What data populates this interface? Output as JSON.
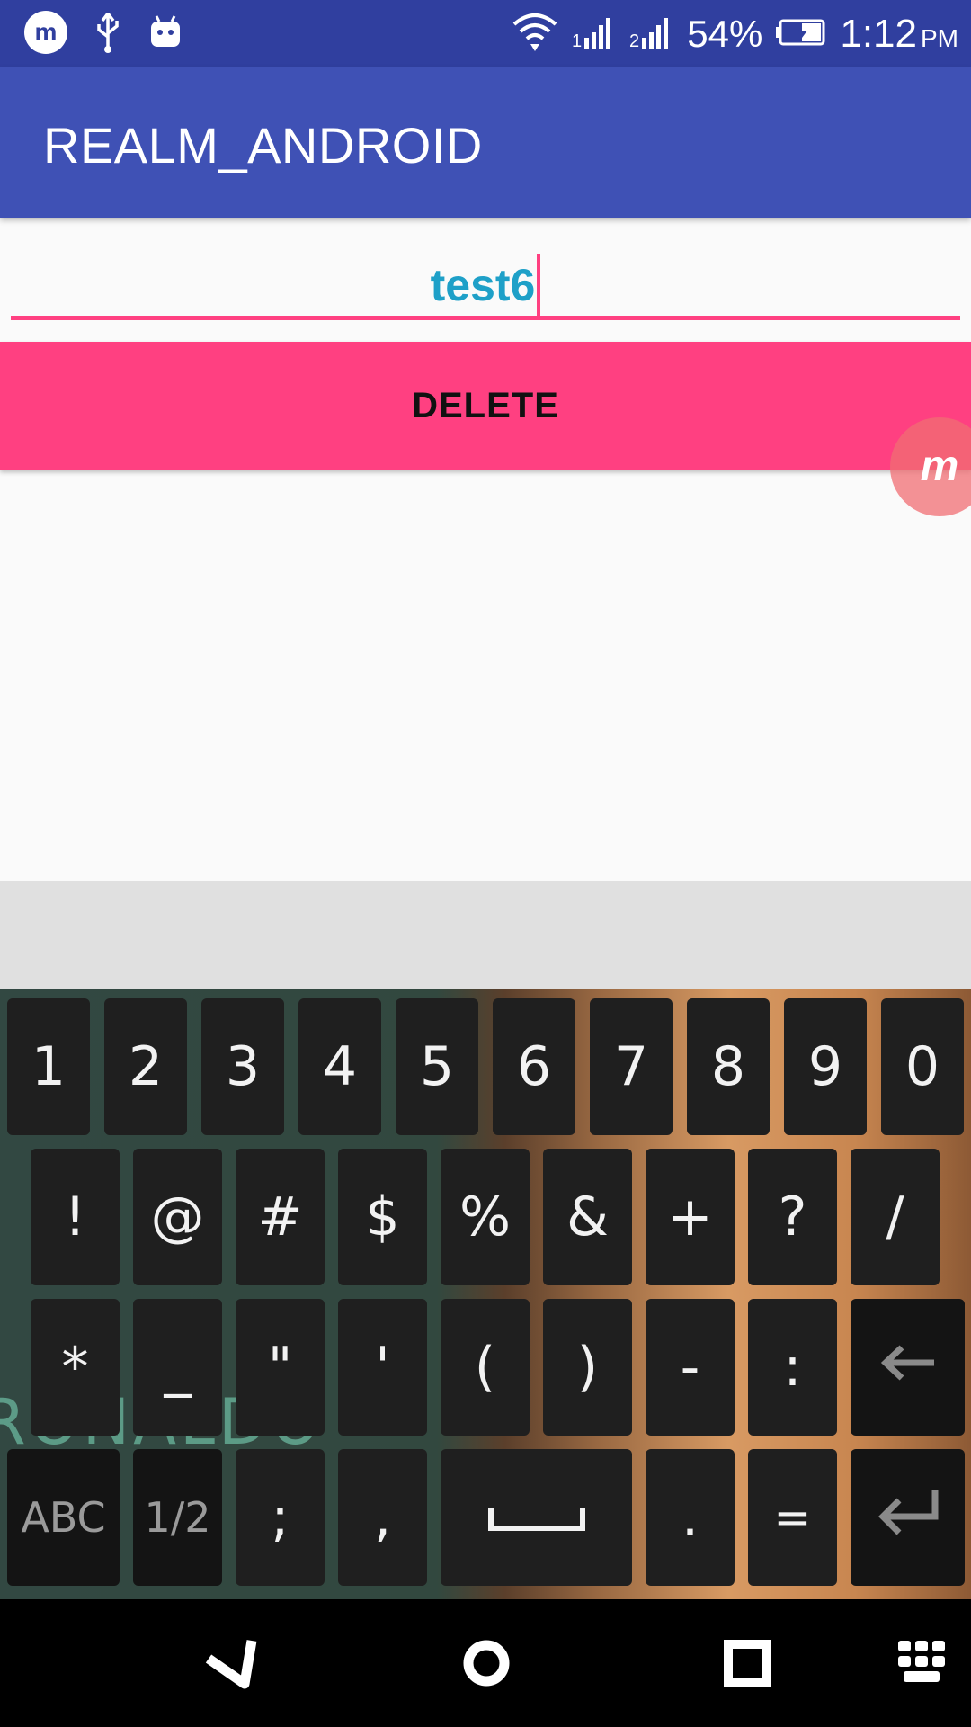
{
  "status_bar": {
    "battery": "54%",
    "time": "1:12",
    "ampm": "PM",
    "icons": [
      "mobizen-icon",
      "usb-icon",
      "android-debug-icon",
      "wifi-icon",
      "signal-sim1-icon",
      "signal-sim2-icon",
      "battery-charging-icon"
    ]
  },
  "app_bar": {
    "title": "REALM_ANDROID"
  },
  "input": {
    "value": "test6"
  },
  "delete_button": {
    "label": "DELETE"
  },
  "colors": {
    "primary": "#3f51b5",
    "primary_dark": "#303f9f",
    "accent": "#ff4081",
    "input_text": "#1ea0c8"
  },
  "keyboard": {
    "row1": [
      "1",
      "2",
      "3",
      "4",
      "5",
      "6",
      "7",
      "8",
      "9",
      "0"
    ],
    "row2": [
      "!",
      "@",
      "#",
      "$",
      "%",
      "&",
      "+",
      "?",
      "/"
    ],
    "row3": [
      "*",
      "_",
      "\"",
      "'",
      "(",
      ")",
      "-",
      ":"
    ],
    "row4": {
      "abc": "ABC",
      "page": "1/2",
      "semicolon": ";",
      "comma": ",",
      "period": ".",
      "equals": "="
    },
    "background_text": "RONALDO",
    "icons": [
      "backspace-icon",
      "space-icon",
      "enter-icon"
    ]
  },
  "nav_bar": {
    "icons": [
      "back-icon",
      "home-icon",
      "recents-icon",
      "keyboard-switch-icon"
    ]
  }
}
